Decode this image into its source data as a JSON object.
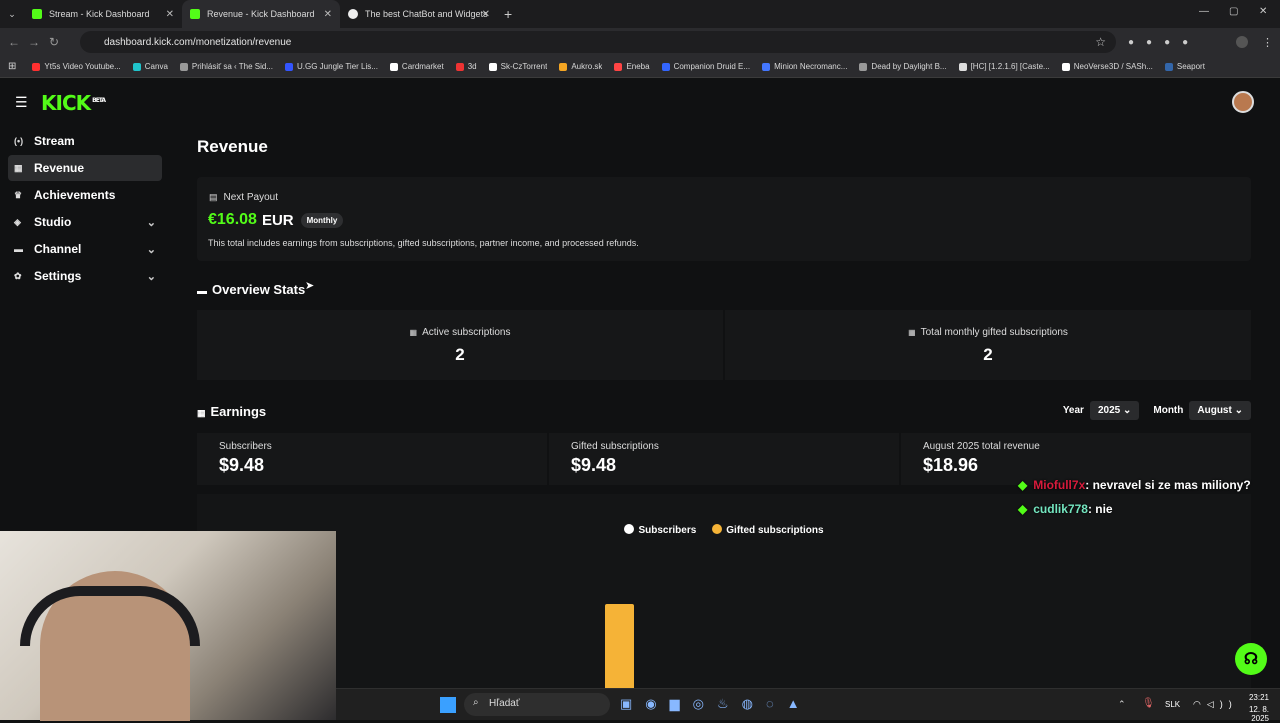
{
  "browser": {
    "tabs": [
      {
        "title": "Stream - Kick Dashboard",
        "active": false
      },
      {
        "title": "Revenue - Kick Dashboard",
        "active": true
      },
      {
        "title": "The best ChatBot and Widgets",
        "active": false
      }
    ],
    "url": "dashboard.kick.com/monetization/revenue",
    "bookmarks": [
      "Yt5s Video Youtube...",
      "Canva",
      "Prihlásiť sa ‹ The Sid...",
      "U.GG Jungle Tier Lis...",
      "Cardmarket",
      "3d",
      "Sk-CzTorrent",
      "Aukro.sk",
      "Eneba",
      "Companion Druid E...",
      "Minion Necromanc...",
      "Dead by Daylight B...",
      "[HC] [1.2.1.6] [Caste...",
      "NeoVerse3D / SASh...",
      "Seaport"
    ]
  },
  "app": {
    "logo": "KICK",
    "logo_badge": "BETA"
  },
  "sidebar": {
    "items": [
      {
        "label": "Stream",
        "icon": "stream-icon",
        "active": false,
        "expandable": false
      },
      {
        "label": "Revenue",
        "icon": "revenue-icon",
        "active": true,
        "expandable": false
      },
      {
        "label": "Achievements",
        "icon": "trophy-icon",
        "active": false,
        "expandable": false
      },
      {
        "label": "Studio",
        "icon": "studio-icon",
        "active": false,
        "expandable": true
      },
      {
        "label": "Channel",
        "icon": "channel-icon",
        "active": false,
        "expandable": true
      },
      {
        "label": "Settings",
        "icon": "gear-icon",
        "active": false,
        "expandable": true
      }
    ]
  },
  "page": {
    "title": "Revenue",
    "payout": {
      "label": "Next Payout",
      "amount": "€16.08",
      "currency": "EUR",
      "badge": "Monthly",
      "note": "This total includes earnings from subscriptions, gifted subscriptions, partner income, and processed refunds."
    },
    "overview": {
      "title": "Overview Stats",
      "stats": [
        {
          "label": "Active subscriptions",
          "value": "2"
        },
        {
          "label": "Total monthly gifted subscriptions",
          "value": "2"
        }
      ]
    },
    "earnings": {
      "title": "Earnings",
      "year_label": "Year",
      "year_value": "2025",
      "month_label": "Month",
      "month_value": "August",
      "cards": [
        {
          "label": "Subscribers",
          "value": "$9.48"
        },
        {
          "label": "Gifted subscriptions",
          "value": "$9.48"
        },
        {
          "label": "August 2025 total revenue",
          "value": "$18.96"
        }
      ]
    }
  },
  "chart_data": {
    "type": "bar",
    "stacked": true,
    "series": [
      {
        "name": "Subscribers",
        "color": "#ffffff",
        "values": [
          9.48
        ]
      },
      {
        "name": "Gifted subscriptions",
        "color": "#f5b337",
        "values": [
          9.48
        ]
      }
    ],
    "legend": "top-center"
  },
  "chat": [
    {
      "user": "Miofull7x",
      "color": "#d81b3c",
      "message": ": nevravel si ze mas miliony?"
    },
    {
      "user": "cudlik778",
      "color": "#74e6c0",
      "message": ": nie"
    }
  ],
  "taskbar": {
    "search_placeholder": "Hľadať",
    "lang": "SLK",
    "time": "23:21",
    "date": "12. 8. 2025"
  }
}
